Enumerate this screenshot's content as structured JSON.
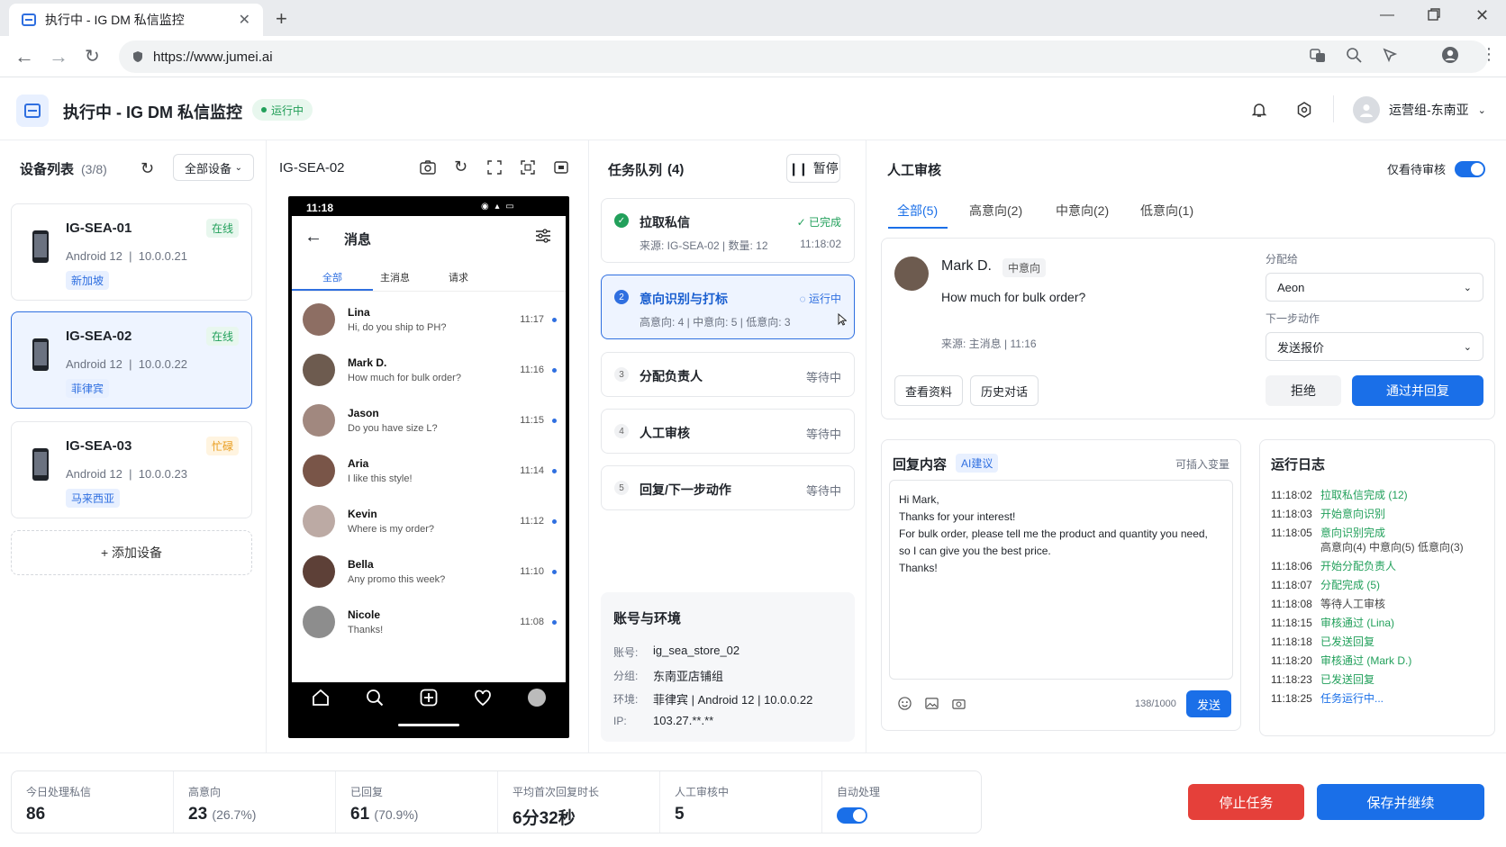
{
  "browser": {
    "tab_title": "执行中 - IG DM 私信监控",
    "url": "https://www.jumei.ai"
  },
  "header": {
    "title": "执行中 - IG DM 私信监控",
    "status": "运行中",
    "user": "运营组-东南亚"
  },
  "devices": {
    "title": "设备列表",
    "count": "(3/8)",
    "filter": "全部设备",
    "add_label": "+ 添加设备",
    "items": [
      {
        "name": "IG-SEA-01",
        "os": "Android 12",
        "ip": "10.0.0.21",
        "status": "在线",
        "location": "新加坡"
      },
      {
        "name": "IG-SEA-02",
        "os": "Android 12",
        "ip": "10.0.0.22",
        "status": "在线",
        "location": "菲律宾"
      },
      {
        "name": "IG-SEA-03",
        "os": "Android 12",
        "ip": "10.0.0.23",
        "status": "忙碌",
        "location": "马来西亚"
      }
    ]
  },
  "phone": {
    "device_title": "IG-SEA-02",
    "time": "11:18",
    "screen_title": "消息",
    "tabs": [
      "全部",
      "主消息",
      "请求"
    ],
    "chats": [
      {
        "name": "Lina",
        "msg": "Hi, do you ship to PH?",
        "time": "11:17"
      },
      {
        "name": "Mark D.",
        "msg": "How much for bulk order?",
        "time": "11:16"
      },
      {
        "name": "Jason",
        "msg": "Do you have size L?",
        "time": "11:15"
      },
      {
        "name": "Aria",
        "msg": "I like this style!",
        "time": "11:14"
      },
      {
        "name": "Kevin",
        "msg": "Where is my order?",
        "time": "11:12"
      },
      {
        "name": "Bella",
        "msg": "Any promo this week?",
        "time": "11:10"
      },
      {
        "name": "Nicole",
        "msg": "Thanks!",
        "time": "11:08"
      }
    ]
  },
  "tasks": {
    "title": "任务队列",
    "count": "(4)",
    "pause_label": "暂停",
    "items": [
      {
        "step": "1",
        "name": "拉取私信",
        "status": "已完成",
        "detail": "来源: IG-SEA-02 | 数量: 12",
        "time": "11:18:02"
      },
      {
        "step": "2",
        "name": "意向识别与打标",
        "status": "运行中",
        "detail": "高意向: 4 | 中意向: 5 | 低意向: 3"
      },
      {
        "step": "3",
        "name": "分配负责人",
        "status": "等待中"
      },
      {
        "step": "4",
        "name": "人工审核",
        "status": "等待中"
      },
      {
        "step": "5",
        "name": "回复/下一步动作",
        "status": "等待中"
      }
    ]
  },
  "account": {
    "title": "账号与环境",
    "rows": [
      {
        "label": "账号:",
        "value": "ig_sea_store_02"
      },
      {
        "label": "分组:",
        "value": "东南亚店铺组"
      },
      {
        "label": "环境:",
        "value": "菲律宾 | Android 12 | 10.0.0.22"
      },
      {
        "label": "IP:",
        "value": "103.27.**.**"
      }
    ]
  },
  "review": {
    "title": "人工审核",
    "only_pending": "仅看待审核",
    "tabs": [
      "全部(5)",
      "高意向(2)",
      "中意向(2)",
      "低意向(1)"
    ],
    "contact": "Mark D.",
    "intent": "中意向",
    "message": "How much for bulk order?",
    "source": "来源: 主消息 | 11:16",
    "view_profile": "查看资料",
    "history": "历史对话",
    "assign_label": "分配给",
    "assign_value": "Aeon",
    "next_label": "下一步动作",
    "next_value": "发送报价",
    "reject": "拒绝",
    "approve": "通过并回复"
  },
  "reply": {
    "title": "回复内容",
    "ai_tag": "AI建议",
    "insert_var": "可插入变量",
    "lines": [
      "Hi Mark,",
      "Thanks for your interest!",
      "For bulk order, please tell me the product and quantity you need,",
      "so I can give you the best price.",
      "Thanks!"
    ],
    "counter": "138/1000",
    "send": "发送"
  },
  "log": {
    "title": "运行日志",
    "entries": [
      {
        "time": "11:18:02",
        "text": "拉取私信完成 (12)",
        "color": "#22a05b"
      },
      {
        "time": "11:18:03",
        "text": "开始意向识别",
        "color": "#22a05b"
      },
      {
        "time": "11:18:05",
        "text": "意向识别完成",
        "color": "#22a05b"
      },
      {
        "time": "",
        "text": "高意向(4)  中意向(5)  低意向(3)",
        "color": "#444444"
      },
      {
        "time": "11:18:06",
        "text": "开始分配负责人",
        "color": "#22a05b"
      },
      {
        "time": "11:18:07",
        "text": "分配完成 (5)",
        "color": "#22a05b"
      },
      {
        "time": "11:18:08",
        "text": "等待人工审核",
        "color": "#444444"
      },
      {
        "time": "11:18:15",
        "text": "审核通过 (Lina)",
        "color": "#22a05b"
      },
      {
        "time": "11:18:18",
        "text": "已发送回复",
        "color": "#22a05b"
      },
      {
        "time": "11:18:20",
        "text": "审核通过 (Mark D.)",
        "color": "#22a05b"
      },
      {
        "time": "11:18:23",
        "text": "已发送回复",
        "color": "#22a05b"
      },
      {
        "time": "11:18:25",
        "text": "任务运行中...",
        "color": "#1a6fe8"
      }
    ]
  },
  "stats": [
    {
      "label": "今日处理私信",
      "value": "86",
      "sub": ""
    },
    {
      "label": "高意向",
      "value": "23",
      "sub": "(26.7%)"
    },
    {
      "label": "已回复",
      "value": "61",
      "sub": "(70.9%)"
    },
    {
      "label": "平均首次回复时长",
      "value": "6分32秒",
      "sub": ""
    },
    {
      "label": "人工审核中",
      "value": "5",
      "sub": ""
    },
    {
      "label": "自动处理",
      "value": "",
      "sub": ""
    }
  ],
  "footer": {
    "stop": "停止任务",
    "save": "保存并继续"
  }
}
